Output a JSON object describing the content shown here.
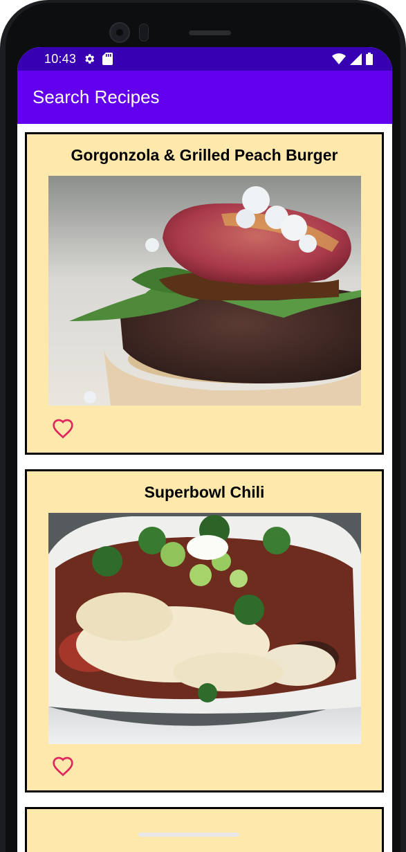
{
  "status_bar": {
    "time": "10:43",
    "icons": [
      "settings-icon",
      "sd-card-icon",
      "wifi-icon",
      "signal-icon",
      "battery-icon"
    ]
  },
  "app_bar": {
    "title": "Search Recipes"
  },
  "colors": {
    "status_bar": "#3700b3",
    "app_bar": "#6200ee",
    "card_background": "#ffe8ab",
    "card_border": "#000000",
    "favorite_icon": "#e0245e"
  },
  "recipes": [
    {
      "title": "Gorgonzola & Grilled Peach Burger",
      "image": "burger-photo",
      "favorite_icon": "heart-outline-icon"
    },
    {
      "title": "Superbowl Chili",
      "image": "chili-photo",
      "favorite_icon": "heart-outline-icon"
    }
  ]
}
